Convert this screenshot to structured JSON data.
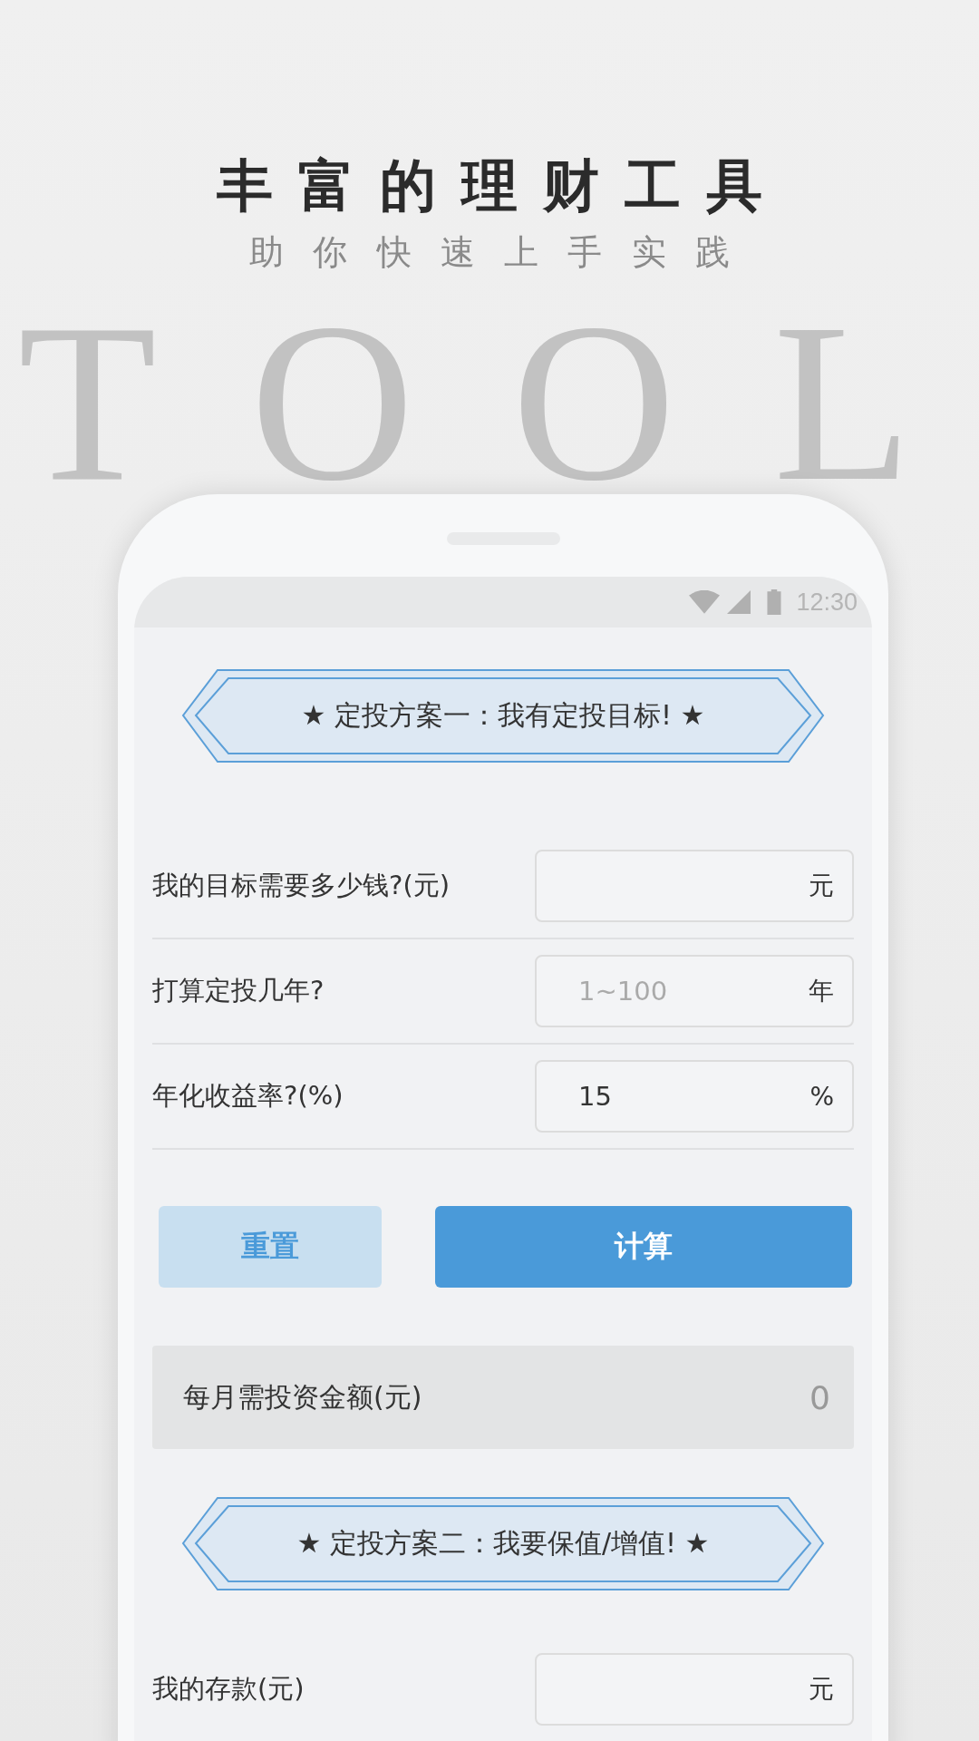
{
  "header": {
    "backdrop_word": "TOOL",
    "title": "丰富的理财工具",
    "subtitle": "助你快速上手实践"
  },
  "status_bar": {
    "time": "12:30"
  },
  "sections": [
    {
      "banner": "★ 定投方案一：我有定投目标! ★",
      "rows": [
        {
          "label": "我的目标需要多少钱?(元)",
          "unit": "元"
        },
        {
          "label": "打算定投几年?",
          "placeholder": "1~100",
          "unit": "年"
        },
        {
          "label": "年化收益率?(%)",
          "value": "15",
          "unit": "%"
        }
      ],
      "buttons": [
        {
          "label": "重置",
          "kind": "secondary"
        },
        {
          "label": "计算",
          "kind": "primary"
        }
      ],
      "result": {
        "label": "每月需投资金额(元)",
        "value": "0"
      }
    },
    {
      "banner": "★ 定投方案二：我要保值/增值! ★",
      "rows": [
        {
          "label": "我的存款(元)",
          "unit": "元"
        }
      ]
    }
  ]
}
